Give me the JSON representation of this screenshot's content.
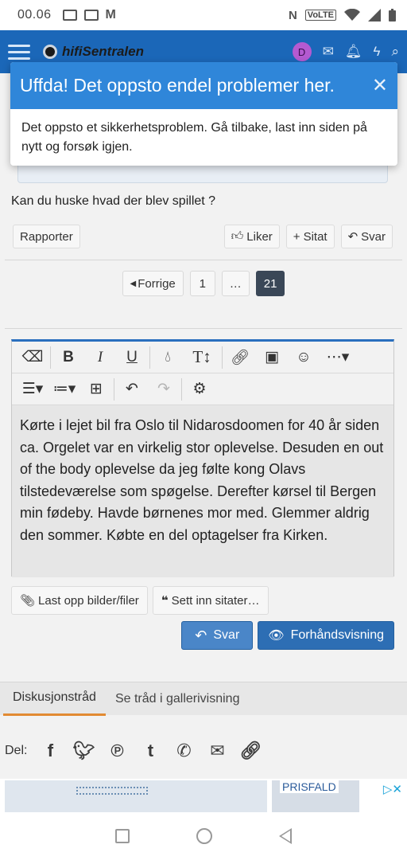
{
  "status_bar": {
    "time": "00.06",
    "network_label": "VoLTE"
  },
  "header": {
    "logo_text": "hifiSentralen",
    "avatar_letter": "D"
  },
  "dialog": {
    "title": "Uffda! Det oppsto endel problemer her.",
    "close_glyph": "✕",
    "message": "Det oppsto et sikkerhetsproblem. Gå tilbake, last inn siden på nytt og forsøk igjen."
  },
  "post": {
    "text": "Kan du huske hvad der blev spillet ?",
    "report_label": "Rapporter",
    "like_label": "Liker",
    "quote_label": "Sitat",
    "reply_label": "Svar"
  },
  "pagination": {
    "prev_label": "Forrige",
    "page_first": "1",
    "ellipsis": "…",
    "page_current": "21"
  },
  "editor": {
    "body": "Kørte i lejet bil fra Oslo til Nidarosdoomen for 40 år siden ca. Orgelet var en virkelig stor oplevelse. Desuden en out of the body oplevelse da jeg følte kong Olavs tilstedeværelse som spøgelse. Derefter kørsel til Bergen min fødeby. Havde børnenes mor med. Glemmer aldrig den sommer. Købte en del optagelser fra Kirken.",
    "toolbar_icons": [
      "eraser-icon",
      "bold-icon",
      "italic-icon",
      "underline-icon",
      "color-drop-icon",
      "text-size-icon",
      "link-icon",
      "image-icon",
      "smiley-icon",
      "more-icon",
      "align-icon",
      "list-icon",
      "table-icon",
      "undo-icon",
      "redo-icon",
      "settings-icon"
    ]
  },
  "actions": {
    "upload_label": "Last opp bilder/filer",
    "insert_quotes_label": "Sett inn sitater…",
    "reply_label": "Svar",
    "preview_label": "Forhåndsvisning"
  },
  "tabs": [
    {
      "label": "Diskusjonstråd",
      "active": true
    },
    {
      "label": "Se tråd i gallerivisning",
      "active": false
    }
  ],
  "share": {
    "label": "Del:",
    "icons": [
      "facebook-icon",
      "twitter-icon",
      "pinterest-icon",
      "tumblr-icon",
      "whatsapp-icon",
      "email-icon",
      "link-icon"
    ]
  },
  "ad": {
    "badge": "PRISFALD"
  },
  "colors": {
    "brand_blue": "#1b67b8",
    "dialog_header": "#2f86d9",
    "primary_button": "#2d6eb4",
    "tab_accent": "#e28a32",
    "pager_active": "#3a4757"
  }
}
